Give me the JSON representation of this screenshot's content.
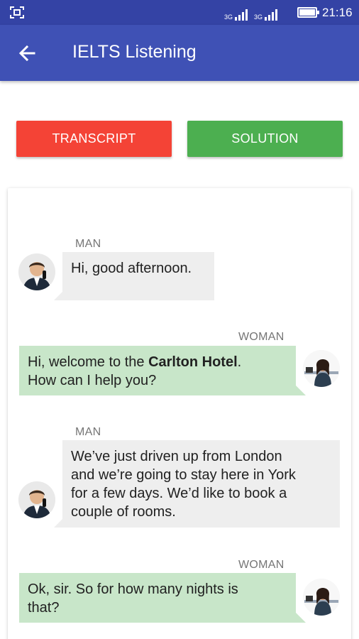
{
  "status_bar": {
    "network_left": "3G",
    "network_right": "3G",
    "time": "21:16"
  },
  "app_bar": {
    "title": "IELTS Listening",
    "back_icon": "arrow-left-icon"
  },
  "buttons": {
    "transcript_label": "TRANSCRIPT",
    "solution_label": "SOLUTION"
  },
  "colors": {
    "primary": "#3f51b5",
    "primary_dark": "#3443a5",
    "transcript": "#f44336",
    "solution": "#4caf50",
    "man_bubble": "#eeeeee",
    "woman_bubble": "#c8e6c9"
  },
  "conversation": [
    {
      "speaker": "MAN",
      "lines": [
        "Hi, good afternoon."
      ]
    },
    {
      "speaker": "WOMAN",
      "line1_prefix": "Hi, welcome to the ",
      "line1_bold": "Carlton Hotel",
      "line1_suffix": ".",
      "line2": "How can I help you?"
    },
    {
      "speaker": "MAN",
      "lines": [
        "We’ve just driven up from London",
        "and we’re going to stay here in York",
        "for a few days. We’d like to book a",
        "couple of rooms."
      ]
    },
    {
      "speaker": "WOMAN",
      "lines": [
        "Ok, sir. So for how many nights is",
        "that?"
      ]
    }
  ]
}
